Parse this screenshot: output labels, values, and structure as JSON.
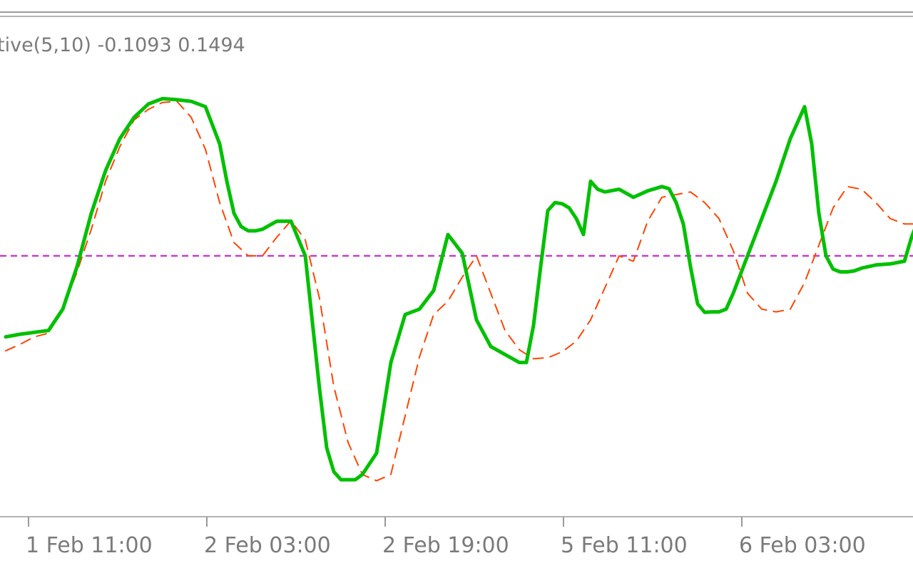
{
  "indicator_label": "tive(5,10) -0.1093 0.1494",
  "colors": {
    "background": "#ffffff",
    "main_line": "#00c000",
    "signal_line": "#ff4500",
    "zero_line": "#c83ccf",
    "frame": "#9a9a9a",
    "axis_text": "#7a7a7a"
  },
  "chart_data": {
    "type": "line",
    "title": "",
    "xlabel": "",
    "ylabel": "",
    "ylim": [
      -0.48,
      0.44
    ],
    "grid": false,
    "legend": "none",
    "x_ticks": [
      {
        "label": "1 Feb 11:00",
        "x": 3
      },
      {
        "label": "2 Feb 03:00",
        "x": 28
      },
      {
        "label": "2 Feb 19:00",
        "x": 53
      },
      {
        "label": "5 Feb 11:00",
        "x": 78
      },
      {
        "label": "6 Feb 03:00",
        "x": 103
      }
    ],
    "reference_line": {
      "value": 0,
      "style": "dashed"
    },
    "series": [
      {
        "style": "solid",
        "x": [
          0,
          2,
          6,
          8,
          10,
          12,
          14,
          16,
          18,
          20,
          22,
          24,
          26,
          28,
          30,
          31,
          32,
          33,
          34,
          35,
          36,
          38,
          40,
          42,
          44,
          45,
          46,
          47,
          48,
          49,
          50,
          52,
          54,
          56,
          58,
          60,
          62,
          64,
          66,
          68,
          70,
          72,
          73,
          74,
          75,
          76,
          77,
          78,
          79,
          80,
          81,
          82,
          83,
          84,
          86,
          88,
          90,
          92,
          93,
          94,
          95,
          96,
          97,
          98,
          99,
          100,
          101,
          102,
          104,
          106,
          108,
          110,
          112,
          113,
          114,
          115,
          116,
          117,
          118,
          119,
          120,
          122,
          124,
          126,
          127,
          128
        ],
        "values": [
          -0.152,
          -0.147,
          -0.14,
          -0.1,
          -0.02,
          0.08,
          0.16,
          0.22,
          0.26,
          0.285,
          0.295,
          0.293,
          0.29,
          0.28,
          0.21,
          0.14,
          0.08,
          0.055,
          0.047,
          0.047,
          0.05,
          0.065,
          0.065,
          0.0,
          -0.25,
          -0.36,
          -0.405,
          -0.42,
          -0.42,
          -0.42,
          -0.41,
          -0.37,
          -0.2,
          -0.11,
          -0.1,
          -0.065,
          0.04,
          0.005,
          -0.12,
          -0.17,
          -0.185,
          -0.2,
          -0.2,
          -0.13,
          -0.02,
          0.085,
          0.1,
          0.098,
          0.09,
          0.07,
          0.04,
          0.14,
          0.125,
          0.12,
          0.125,
          0.11,
          0.122,
          0.13,
          0.126,
          0.1,
          0.06,
          -0.02,
          -0.09,
          -0.106,
          -0.105,
          -0.105,
          -0.1,
          -0.07,
          0.0,
          0.07,
          0.14,
          0.22,
          0.28,
          0.21,
          0.08,
          0.0,
          -0.025,
          -0.03,
          -0.03,
          -0.028,
          -0.023,
          -0.017,
          -0.015,
          -0.01,
          0.035,
          0.07
        ]
      },
      {
        "style": "dashed",
        "x": [
          0,
          2,
          4,
          6,
          8,
          10,
          12,
          14,
          16,
          18,
          20,
          22,
          24,
          26,
          28,
          30,
          32,
          34,
          36,
          38,
          40,
          42,
          44,
          46,
          48,
          50,
          52,
          54,
          56,
          58,
          60,
          62,
          64,
          66,
          68,
          70,
          72,
          74,
          76,
          78,
          80,
          82,
          84,
          86,
          88,
          90,
          92,
          94,
          96,
          98,
          100,
          102,
          104,
          106,
          108,
          110,
          112,
          114,
          116,
          118,
          120,
          122,
          124,
          126,
          128
        ],
        "values": [
          -0.178,
          -0.166,
          -0.152,
          -0.145,
          -0.1,
          -0.03,
          0.05,
          0.14,
          0.205,
          0.255,
          0.275,
          0.288,
          0.29,
          0.26,
          0.2,
          0.1,
          0.025,
          0.0,
          0.0,
          0.035,
          0.066,
          0.03,
          -0.08,
          -0.245,
          -0.35,
          -0.41,
          -0.422,
          -0.41,
          -0.3,
          -0.19,
          -0.11,
          -0.085,
          -0.04,
          0.0,
          -0.07,
          -0.14,
          -0.176,
          -0.193,
          -0.191,
          -0.18,
          -0.16,
          -0.12,
          -0.06,
          0.0,
          -0.01,
          0.065,
          0.11,
          0.115,
          0.12,
          0.1,
          0.07,
          0.01,
          -0.07,
          -0.1,
          -0.105,
          -0.1,
          -0.05,
          0.02,
          0.09,
          0.13,
          0.125,
          0.1,
          0.07,
          0.06,
          0.06
        ]
      }
    ]
  }
}
